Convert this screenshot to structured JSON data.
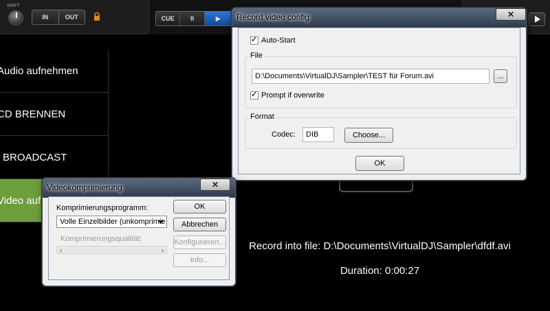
{
  "topbar": {
    "shift_label": "SHIFT",
    "in_label": "IN",
    "out_label": "OUT",
    "cue_label": "CUE",
    "pause_label": "II",
    "play_label": "▶"
  },
  "menu": {
    "items": [
      {
        "label": "Audio aufnehmen"
      },
      {
        "label": "CD BRENNEN"
      },
      {
        "label": "BROADCAST"
      },
      {
        "label": "Video auf"
      }
    ]
  },
  "status": {
    "record_into": "Record into file: D:\\Documents\\VirtualDJ\\Sampler\\dfdf.avi",
    "duration": "Duration: 0:00:27"
  },
  "record_dialog": {
    "title": "Record video config",
    "close_label": "✕",
    "auto_start_label": "Auto-Start",
    "auto_start_checked": true,
    "file_group_label": "File",
    "file_path": "D:\\Documents\\VirtualDJ\\Sampler\\TEST für Forum.avi",
    "browse_label": "...",
    "prompt_overwrite_label": "Prompt if overwrite",
    "prompt_overwrite_checked": true,
    "format_group_label": "Format",
    "codec_label": "Codec:",
    "codec_value": "DIB",
    "choose_label": "Choose...",
    "ok_label": "OK"
  },
  "video_dialog": {
    "title": "Videokomprimierung",
    "close_label": "✕",
    "program_label": "Komprimierungsprogramm:",
    "program_value": "Volle Einzelbilder (unkomprimie",
    "quality_label": "Komprimierungsqualität:",
    "ok_label": "OK",
    "cancel_label": "Abbrechen",
    "configure_label": "Konfigurieren...",
    "info_label": "Info..."
  }
}
